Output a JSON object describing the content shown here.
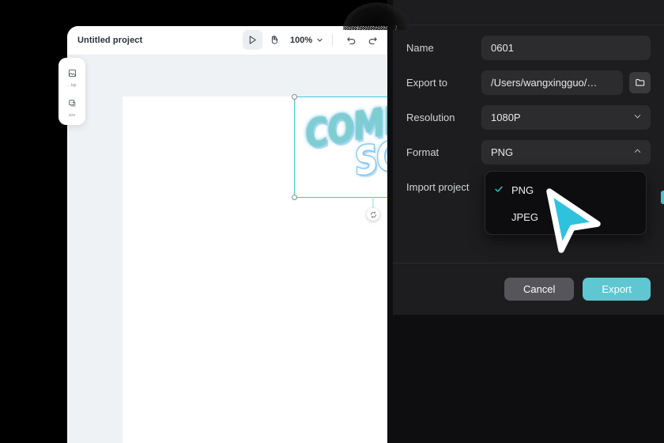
{
  "editor": {
    "window_title": "Untitled project",
    "back_icon": "chevron-left-icon",
    "toolbar": {
      "select_tool": "select-tool",
      "hand_tool": "hand-tool",
      "zoom_level": "100%",
      "zoom_chevron": "chevron-down-icon",
      "undo": "undo-icon",
      "redo": "redo-icon"
    },
    "sidebar": {
      "items": [
        {
          "icon": "background-icon",
          "label": "kgr…"
        },
        {
          "icon": "resize-icon",
          "label": "size"
        }
      ]
    },
    "canvas": {
      "selection": {
        "wordart_line1": "COMING",
        "wordart_line2": "SOON!",
        "rotate_handle": "rotate-handle-icon",
        "line1_color": "#7ececf",
        "line2_color": "#ffffff",
        "selection_color": "#3ec8e0"
      }
    }
  },
  "export_dialog": {
    "fields": [
      {
        "label": "Name",
        "value": "0601",
        "type": "text"
      },
      {
        "label": "Export to",
        "value": "/Users/wangxingguo/…",
        "type": "path",
        "button_icon": "folder-icon"
      },
      {
        "label": "Resolution",
        "value": "1080P",
        "type": "select",
        "chevron": "chevron-down-icon"
      },
      {
        "label": "Format",
        "value": "PNG",
        "type": "select",
        "chevron": "chevron-up-icon"
      },
      {
        "label": "Import project",
        "value": "",
        "type": "toggle"
      }
    ],
    "format_dropdown": {
      "options": [
        {
          "label": "PNG",
          "selected": true,
          "check_icon": "check-icon"
        },
        {
          "label": "JPEG",
          "selected": false,
          "check_icon": ""
        }
      ]
    },
    "footer": {
      "cancel_label": "Cancel",
      "export_label": "Export",
      "cancel_color": "#55555a",
      "export_color": "#5fc7d1"
    }
  },
  "pointer": {
    "name": "mouse-cursor",
    "fill": "#2ec2dd",
    "stroke": "#ffffff"
  }
}
